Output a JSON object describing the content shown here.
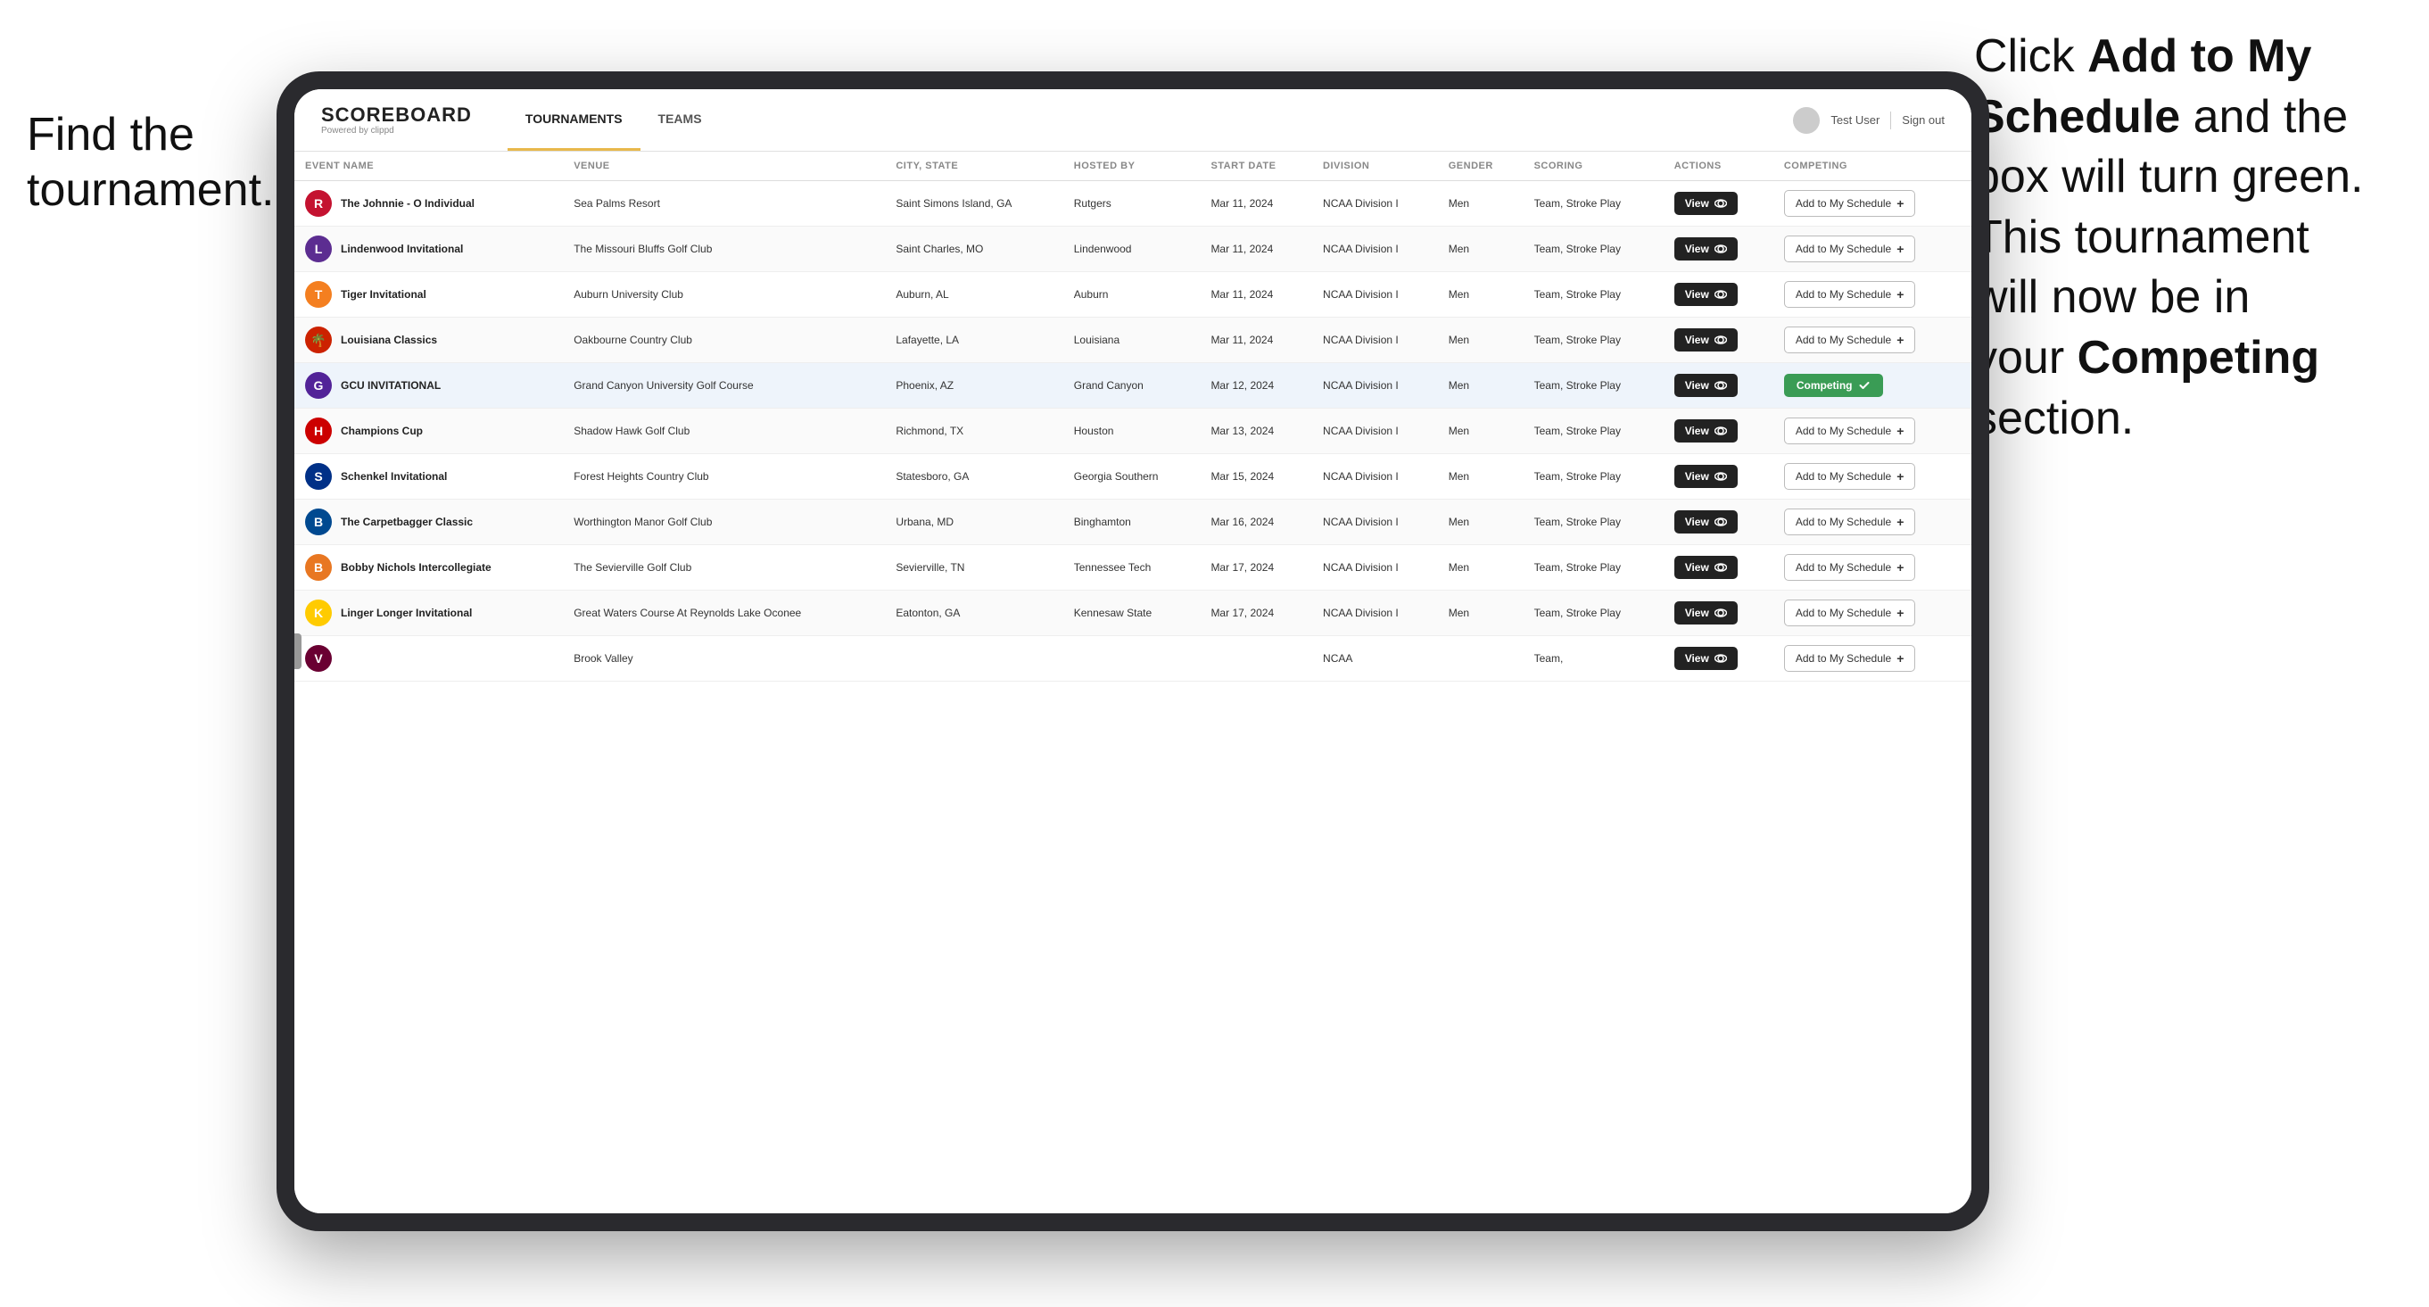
{
  "annotations": {
    "left": "Find the\ntournament.",
    "right_line1": "Click ",
    "right_bold1": "Add to My\nSchedule",
    "right_line2": " and the\nbox will turn green.\nThis tournament\nwill now be in\nyour ",
    "right_bold2": "Competing",
    "right_line3": "\nsection."
  },
  "app": {
    "logo_main": "SCOREBOARD",
    "logo_sub": "Powered by clippd",
    "nav": [
      {
        "label": "TOURNAMENTS",
        "active": true
      },
      {
        "label": "TEAMS",
        "active": false
      }
    ],
    "user_label": "Test User",
    "sign_out_label": "Sign out"
  },
  "table": {
    "columns": [
      "EVENT NAME",
      "VENUE",
      "CITY, STATE",
      "HOSTED BY",
      "START DATE",
      "DIVISION",
      "GENDER",
      "SCORING",
      "ACTIONS",
      "COMPETING"
    ],
    "rows": [
      {
        "logo_text": "R",
        "logo_color": "#c41230",
        "event": "The Johnnie - O Individual",
        "venue": "Sea Palms Resort",
        "city": "Saint Simons Island, GA",
        "hosted": "Rutgers",
        "date": "Mar 11, 2024",
        "division": "NCAA Division I",
        "gender": "Men",
        "scoring": "Team, Stroke Play",
        "action": "View",
        "competing_type": "add",
        "competing_label": "Add to My Schedule",
        "highlighted": false
      },
      {
        "logo_text": "L",
        "logo_color": "#5c2d91",
        "event": "Lindenwood Invitational",
        "venue": "The Missouri Bluffs Golf Club",
        "city": "Saint Charles, MO",
        "hosted": "Lindenwood",
        "date": "Mar 11, 2024",
        "division": "NCAA Division I",
        "gender": "Men",
        "scoring": "Team, Stroke Play",
        "action": "View",
        "competing_type": "add",
        "competing_label": "Add to My Schedule",
        "highlighted": false
      },
      {
        "logo_text": "T",
        "logo_color": "#f47f20",
        "event": "Tiger Invitational",
        "venue": "Auburn University Club",
        "city": "Auburn, AL",
        "hosted": "Auburn",
        "date": "Mar 11, 2024",
        "division": "NCAA Division I",
        "gender": "Men",
        "scoring": "Team, Stroke Play",
        "action": "View",
        "competing_type": "add",
        "competing_label": "Add to My Schedule",
        "highlighted": false
      },
      {
        "logo_text": "🌴",
        "logo_color": "#cc2200",
        "event": "Louisiana Classics",
        "venue": "Oakbourne Country Club",
        "city": "Lafayette, LA",
        "hosted": "Louisiana",
        "date": "Mar 11, 2024",
        "division": "NCAA Division I",
        "gender": "Men",
        "scoring": "Team, Stroke Play",
        "action": "View",
        "competing_type": "add",
        "competing_label": "Add to My Schedule",
        "highlighted": false
      },
      {
        "logo_text": "G",
        "logo_color": "#522398",
        "event": "GCU INVITATIONAL",
        "venue": "Grand Canyon University Golf Course",
        "city": "Phoenix, AZ",
        "hosted": "Grand Canyon",
        "date": "Mar 12, 2024",
        "division": "NCAA Division I",
        "gender": "Men",
        "scoring": "Team, Stroke Play",
        "action": "View",
        "competing_type": "competing",
        "competing_label": "Competing",
        "highlighted": true
      },
      {
        "logo_text": "H",
        "logo_color": "#cc0000",
        "event": "Champions Cup",
        "venue": "Shadow Hawk Golf Club",
        "city": "Richmond, TX",
        "hosted": "Houston",
        "date": "Mar 13, 2024",
        "division": "NCAA Division I",
        "gender": "Men",
        "scoring": "Team, Stroke Play",
        "action": "View",
        "competing_type": "add",
        "competing_label": "Add to My Schedule",
        "highlighted": false
      },
      {
        "logo_text": "S",
        "logo_color": "#003087",
        "event": "Schenkel Invitational",
        "venue": "Forest Heights Country Club",
        "city": "Statesboro, GA",
        "hosted": "Georgia Southern",
        "date": "Mar 15, 2024",
        "division": "NCAA Division I",
        "gender": "Men",
        "scoring": "Team, Stroke Play",
        "action": "View",
        "competing_type": "add",
        "competing_label": "Add to My Schedule",
        "highlighted": false
      },
      {
        "logo_text": "B",
        "logo_color": "#004990",
        "event": "The Carpetbagger Classic",
        "venue": "Worthington Manor Golf Club",
        "city": "Urbana, MD",
        "hosted": "Binghamton",
        "date": "Mar 16, 2024",
        "division": "NCAA Division I",
        "gender": "Men",
        "scoring": "Team, Stroke Play",
        "action": "View",
        "competing_type": "add",
        "competing_label": "Add to My Schedule",
        "highlighted": false
      },
      {
        "logo_text": "B",
        "logo_color": "#e87722",
        "event": "Bobby Nichols Intercollegiate",
        "venue": "The Sevierville Golf Club",
        "city": "Sevierville, TN",
        "hosted": "Tennessee Tech",
        "date": "Mar 17, 2024",
        "division": "NCAA Division I",
        "gender": "Men",
        "scoring": "Team, Stroke Play",
        "action": "View",
        "competing_type": "add",
        "competing_label": "Add to My Schedule",
        "highlighted": false
      },
      {
        "logo_text": "K",
        "logo_color": "#ffcb00",
        "event": "Linger Longer Invitational",
        "venue": "Great Waters Course At Reynolds Lake Oconee",
        "city": "Eatonton, GA",
        "hosted": "Kennesaw State",
        "date": "Mar 17, 2024",
        "division": "NCAA Division I",
        "gender": "Men",
        "scoring": "Team, Stroke Play",
        "action": "View",
        "competing_type": "add",
        "competing_label": "Add to My Schedule",
        "highlighted": false
      },
      {
        "logo_text": "V",
        "logo_color": "#6a0032",
        "event": "",
        "venue": "Brook Valley",
        "city": "",
        "hosted": "",
        "date": "",
        "division": "NCAA",
        "gender": "",
        "scoring": "Team,",
        "action": "View",
        "competing_type": "add",
        "competing_label": "Add to My Schedule",
        "highlighted": false
      }
    ]
  }
}
